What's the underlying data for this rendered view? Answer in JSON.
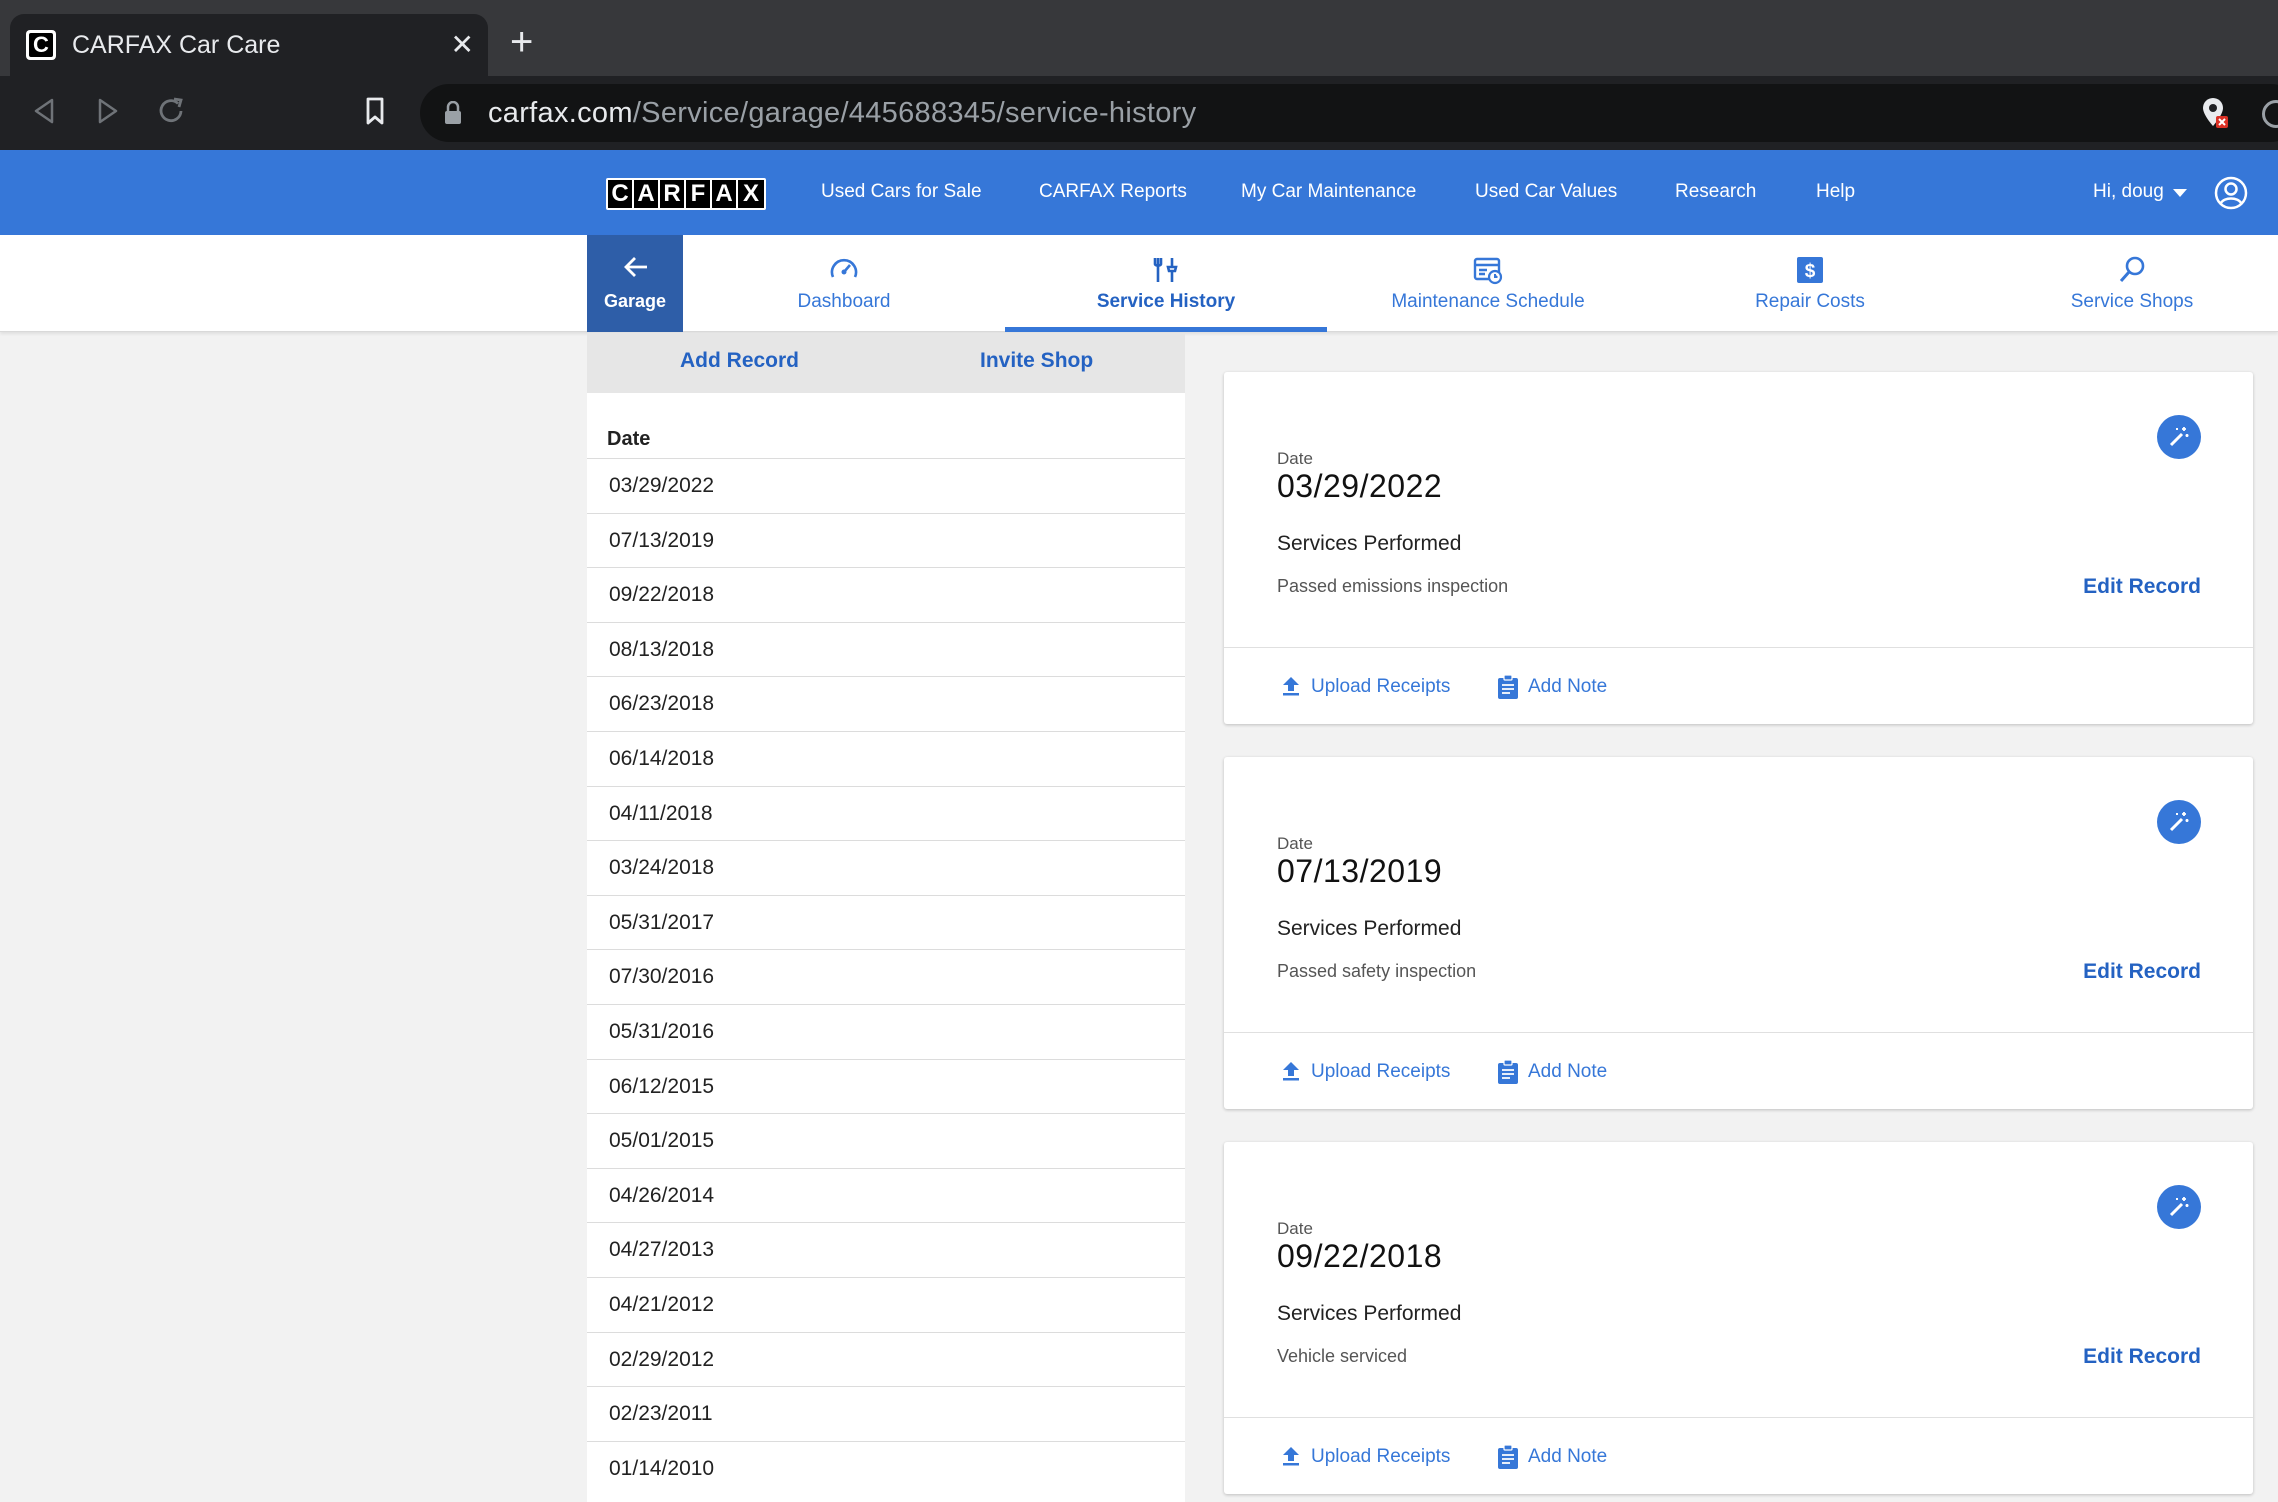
{
  "browser": {
    "tab_title": "CARFAX Car Care",
    "tab_close": "✕",
    "new_tab": "+",
    "url_host": "carfax.com",
    "url_path": "/Service/garage/445688345/service-history"
  },
  "sitenav": {
    "logo_letters": [
      "C",
      "A",
      "R",
      "F",
      "A",
      "X"
    ],
    "links": [
      "Used Cars for Sale",
      "CARFAX Reports",
      "My Car Maintenance",
      "Used Car Values",
      "Research",
      "Help"
    ],
    "greeting": "Hi, doug",
    "brand_color": "#3677d8"
  },
  "subnav": {
    "garage": "Garage",
    "tabs": [
      {
        "label": "Dashboard",
        "icon": "speedometer-icon"
      },
      {
        "label": "Service History",
        "icon": "wrench-icon"
      },
      {
        "label": "Maintenance Schedule",
        "icon": "calendar-icon"
      },
      {
        "label": "Repair Costs",
        "icon": "dollar-icon"
      },
      {
        "label": "Service Shops",
        "icon": "search-icon"
      }
    ],
    "active_tab": "Service History"
  },
  "leftpanel": {
    "add_record": "Add Record",
    "invite_shop": "Invite Shop",
    "date_header": "Date",
    "dates": [
      "03/29/2022",
      "07/13/2019",
      "09/22/2018",
      "08/13/2018",
      "06/23/2018",
      "06/14/2018",
      "04/11/2018",
      "03/24/2018",
      "05/31/2017",
      "07/30/2016",
      "05/31/2016",
      "06/12/2015",
      "05/01/2015",
      "04/26/2014",
      "04/27/2013",
      "04/21/2012",
      "02/29/2012",
      "02/23/2011",
      "01/14/2010"
    ]
  },
  "records": [
    {
      "date_label": "Date",
      "date": "03/29/2022",
      "services_label": "Services Performed",
      "services": "Passed emissions inspection",
      "edit": "Edit Record",
      "upload": "Upload Receipts",
      "note": "Add Note"
    },
    {
      "date_label": "Date",
      "date": "07/13/2019",
      "services_label": "Services Performed",
      "services": "Passed safety inspection",
      "edit": "Edit Record",
      "upload": "Upload Receipts",
      "note": "Add Note"
    },
    {
      "date_label": "Date",
      "date": "09/22/2018",
      "services_label": "Services Performed",
      "services": "Vehicle serviced",
      "edit": "Edit Record",
      "upload": "Upload Receipts",
      "note": "Add Note"
    }
  ]
}
